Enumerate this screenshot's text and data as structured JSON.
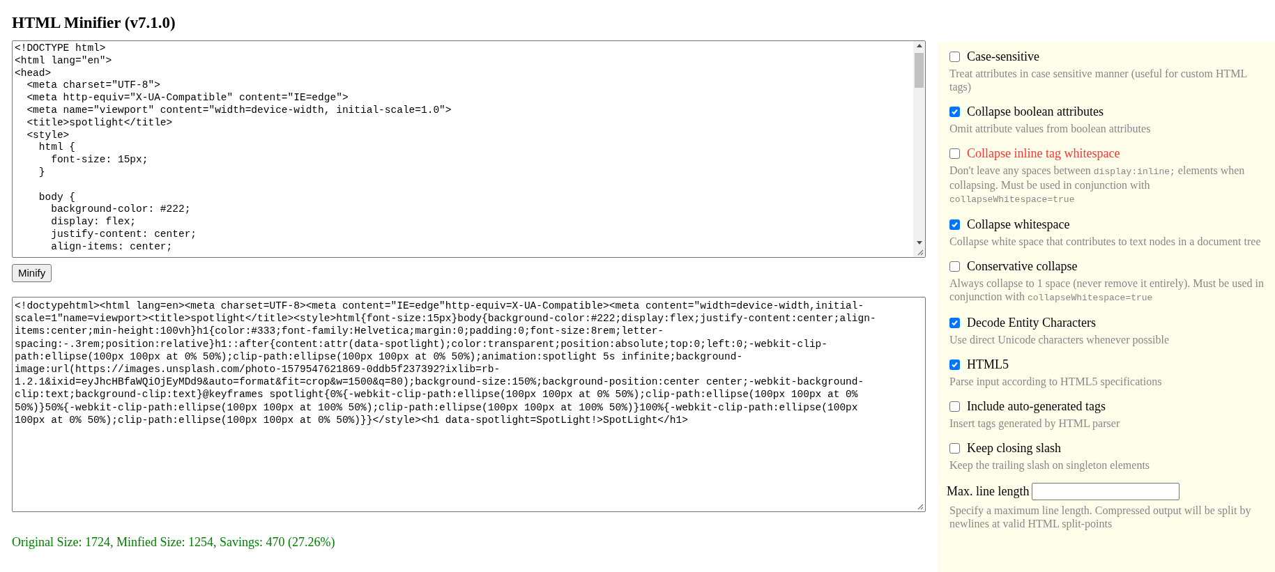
{
  "title": "HTML Minifier (v7.1.0)",
  "input": {
    "text": "<!DOCTYPE html>\n<html lang=\"en\">\n<head>\n  <meta charset=\"UTF-8\">\n  <meta http-equiv=\"X-UA-Compatible\" content=\"IE=edge\">\n  <meta name=\"viewport\" content=\"width=device-width, initial-scale=1.0\">\n  <title>spotlight</title>\n  <style>\n    html {\n      font-size: 15px;\n    }\n\n    body {\n      background-color: #222;\n      display: flex;\n      justify-content: center;\n      align-items: center;"
  },
  "minify_button": "Minify",
  "output": {
    "lines": [
      "<!doctypehtml><html lang=en><meta charset=UTF-8><meta content=\"IE=edge\"http-equiv=X-UA-Compatible><meta content=\"width=device-width,initial-",
      "scale=1\"name=viewport><title>spotlight</title><style>html{font-size:15px}body{background-color:#222;display:flex;justify-content:center;align-",
      "items:center;min-height:100vh}h1{color:#333;font-family:Helvetica;margin:0;padding:0;font-size:8rem;letter-",
      "spacing:-.3rem;position:relative}h1::after{content:attr(data-spotlight);color:transparent;position:absolute;top:0;left:0;-webkit-clip-",
      "path:ellipse(100px 100px at 0% 50%);clip-path:ellipse(100px 100px at 0% 50%);animation:spotlight 5s infinite;background-",
      "image:url(https://images.unsplash.com/photo-1579547621869-0ddb5f237392?ixlib=rb-",
      "1.2.1&ixid=eyJhcHBfaWQiOjEyMDd9&auto=format&fit=crop&w=1500&q=80);background-size:150%;background-position:center center;-webkit-background-",
      "clip:text;background-clip:text}@keyframes spotlight{0%{-webkit-clip-path:ellipse(100px 100px at 0% 50%);clip-path:ellipse(100px 100px at 0%",
      "50%)}50%{-webkit-clip-path:ellipse(100px 100px at 100% 50%);clip-path:ellipse(100px 100px at 100% 50%)}100%{-webkit-clip-path:ellipse(100px",
      "100px at 0% 50%);clip-path:ellipse(100px 100px at 0% 50%)}}</style><h1 data-spotlight=SpotLight!>SpotLight</h1>"
    ]
  },
  "status": "Original Size: 1724, Minfied Size: 1254, Savings: 470 (27.26%)",
  "options": [
    {
      "label": "Case-sensitive",
      "checked": false,
      "warning": false,
      "description": [
        {
          "kind": "text",
          "text": "Treat attributes in case sensitive manner (useful for custom HTML tags)"
        }
      ]
    },
    {
      "label": "Collapse boolean attributes",
      "checked": true,
      "warning": false,
      "description": [
        {
          "kind": "text",
          "text": "Omit attribute values from boolean attributes"
        }
      ]
    },
    {
      "label": "Collapse inline tag whitespace",
      "checked": false,
      "warning": true,
      "description": [
        {
          "kind": "text",
          "text": "Don't leave any spaces between "
        },
        {
          "kind": "code",
          "text": "display:inline;"
        },
        {
          "kind": "text",
          "text": " elements when collapsing. Must be used in conjunction with "
        },
        {
          "kind": "code",
          "text": "collapseWhitespace=true"
        }
      ]
    },
    {
      "label": "Collapse whitespace",
      "checked": true,
      "warning": false,
      "description": [
        {
          "kind": "text",
          "text": "Collapse white space that contributes to text nodes in a document tree"
        }
      ]
    },
    {
      "label": "Conservative collapse",
      "checked": false,
      "warning": false,
      "description": [
        {
          "kind": "text",
          "text": "Always collapse to 1 space (never remove it entirely). Must be used in conjunction with "
        },
        {
          "kind": "code",
          "text": "collapseWhitespace=true"
        }
      ]
    },
    {
      "label": "Decode Entity Characters",
      "checked": true,
      "warning": false,
      "description": [
        {
          "kind": "text",
          "text": "Use direct Unicode characters whenever possible"
        }
      ]
    },
    {
      "label": "HTML5",
      "checked": true,
      "warning": false,
      "description": [
        {
          "kind": "text",
          "text": "Parse input according to HTML5 specifications"
        }
      ]
    },
    {
      "label": "Include auto-generated tags",
      "checked": false,
      "warning": false,
      "description": [
        {
          "kind": "text",
          "text": "Insert tags generated by HTML parser"
        }
      ]
    },
    {
      "label": "Keep closing slash",
      "checked": false,
      "warning": false,
      "description": [
        {
          "kind": "text",
          "text": "Keep the trailing slash on singleton elements"
        }
      ]
    }
  ],
  "max_line_length": {
    "label": "Max. line length",
    "description": "Specify a maximum line length. Compressed output will be split by newlines at valid HTML split-points"
  }
}
